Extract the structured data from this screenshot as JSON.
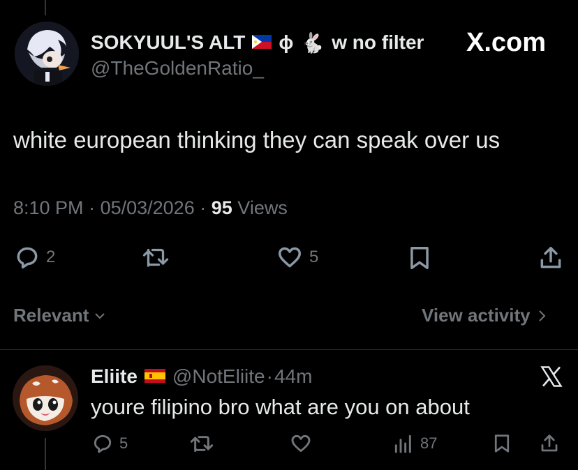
{
  "watermark": "X.com",
  "tweet": {
    "display_name": "SOKYUUL'S ALT",
    "name_suffix": "w no filter",
    "phi": "ϕ",
    "rabbit": "🐇",
    "handle": "@TheGoldenRatio_",
    "text": "white european thinking they can speak over us",
    "time": "8:10 PM",
    "date": "05/03/2026",
    "views_count": "95",
    "views_label": "Views",
    "replies": "2",
    "likes": "5",
    "flag_icon": "philippines-flag-icon"
  },
  "filter": {
    "relevant_label": "Relevant",
    "view_activity_label": "View activity"
  },
  "reply": {
    "display_name": "Eliite",
    "handle": "@NotEliite",
    "time": "44m",
    "text": "youre filipino bro what are you on about",
    "replies": "5",
    "views": "87",
    "flag_icon": "spain-flag-icon"
  },
  "colors": {
    "background": "#000000",
    "text": "#e7e9ea",
    "muted": "#71767b",
    "divider": "#2f3336"
  }
}
